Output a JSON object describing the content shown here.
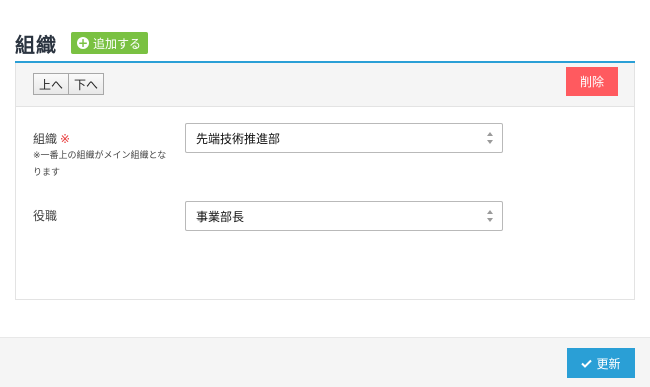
{
  "header": {
    "title": "組織",
    "add_label": "追加する"
  },
  "toolbar": {
    "up_label": "上へ",
    "down_label": "下へ",
    "delete_label": "削除"
  },
  "form": {
    "organization": {
      "label": "組織",
      "required_mark": "※",
      "note": "※一番上の組織がメイン組織となります",
      "value": "先端技術推進部"
    },
    "position": {
      "label": "役職",
      "value": "事業部長"
    }
  },
  "footer": {
    "update_label": "更新"
  },
  "colors": {
    "accent": "#2a9fd6",
    "add": "#7ac142",
    "delete": "#ff5a5f",
    "required": "#e83e3e"
  },
  "icons": {
    "add": "plus-circle-icon",
    "select": "sort-arrows-icon",
    "update": "check-icon"
  }
}
